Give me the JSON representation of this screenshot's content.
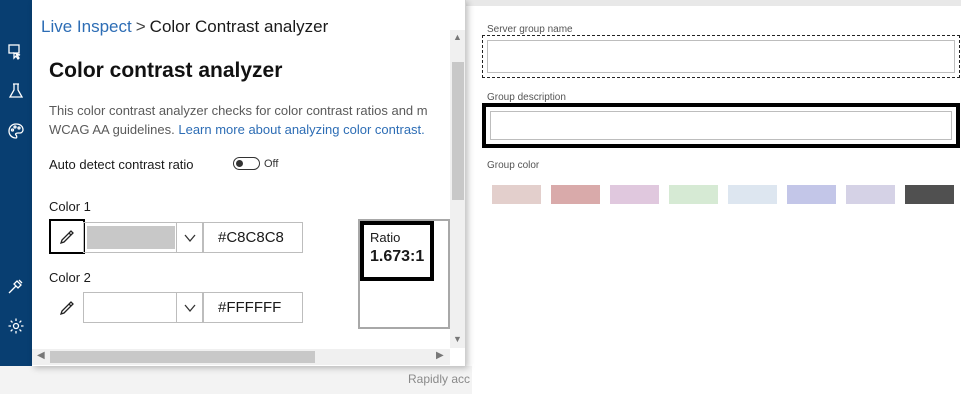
{
  "background_form": {
    "server_group_name_label": "Server group name",
    "group_description_label": "Group description",
    "group_color_label": "Group color",
    "swatch_colors": [
      "#e3cfcc",
      "#d9aaaa",
      "#e0c8de",
      "#d6ead4",
      "#dde6f0",
      "#c3c6e8",
      "#d5d2e6",
      "#505050"
    ],
    "footer_text": "Rapidly acc"
  },
  "rail": {
    "icons": [
      "live-inspect-icon",
      "tests-flask-icon",
      "color-palette-icon",
      "connect-plug-icon",
      "settings-gear-icon"
    ]
  },
  "breadcrumb": {
    "root": "Live Inspect",
    "separator": ">",
    "current": "Color Contrast analyzer"
  },
  "panel": {
    "title": "Color contrast analyzer",
    "description_line1": "This color contrast analyzer checks for color contrast ratios and m",
    "description_line2": "WCAG AA guidelines.",
    "learn_more_link": "Learn more about analyzing color contrast."
  },
  "auto_detect": {
    "label": "Auto detect contrast ratio",
    "state": "Off"
  },
  "color1": {
    "label": "Color 1",
    "hex": "#C8C8C8",
    "swatch": "#C8C8C8"
  },
  "color2": {
    "label": "Color 2",
    "hex": "#FFFFFF",
    "swatch": "#FFFFFF"
  },
  "ratio": {
    "label": "Ratio",
    "value": "1.673:1"
  }
}
